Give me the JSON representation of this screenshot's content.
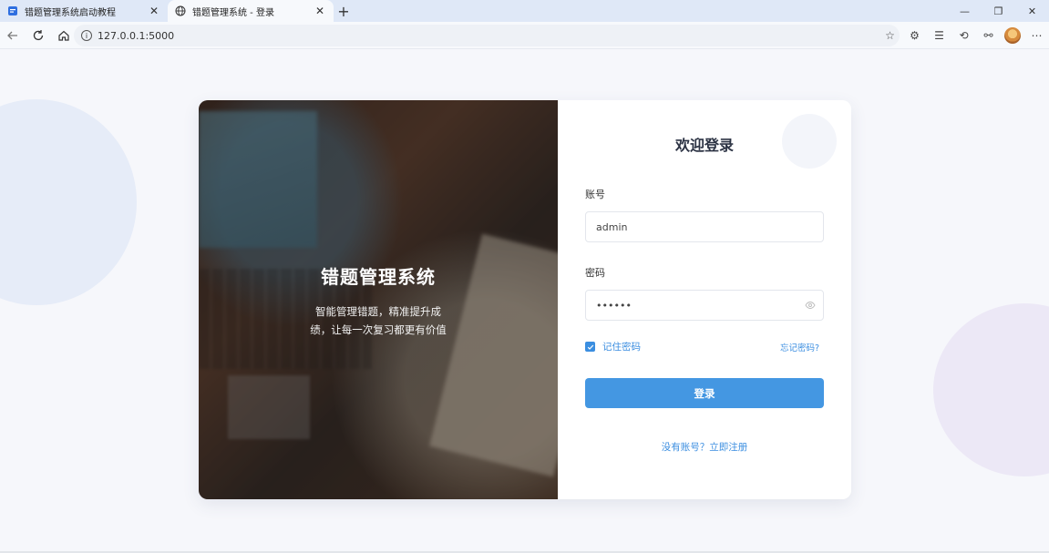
{
  "browser": {
    "tabs": [
      {
        "title": "错题管理系统启动教程",
        "active": false,
        "icon": "document-icon"
      },
      {
        "title": "错题管理系统 - 登录",
        "active": true,
        "icon": "globe-icon"
      }
    ],
    "new_tab_label": "+",
    "url": "127.0.0.1:5000",
    "window_controls": {
      "minimize": "—",
      "restore": "❐",
      "close": "✕"
    }
  },
  "hero": {
    "title": "错题管理系统",
    "subtitle": "智能管理错题，精准提升成绩，让每一次复习都更有价值"
  },
  "form": {
    "heading": "欢迎登录",
    "username_label": "账号",
    "username_value": "admin",
    "password_label": "密码",
    "password_value": "••••••",
    "remember_label": "记住密码",
    "remember_checked": true,
    "forgot_label": "忘记密码?",
    "submit_label": "登录",
    "register_label": "没有账号？立即注册"
  },
  "colors": {
    "accent": "#4497e2",
    "link": "#3b8ee0",
    "page_bg": "#f6f7fb",
    "tab_strip": "#dfe8f7"
  }
}
